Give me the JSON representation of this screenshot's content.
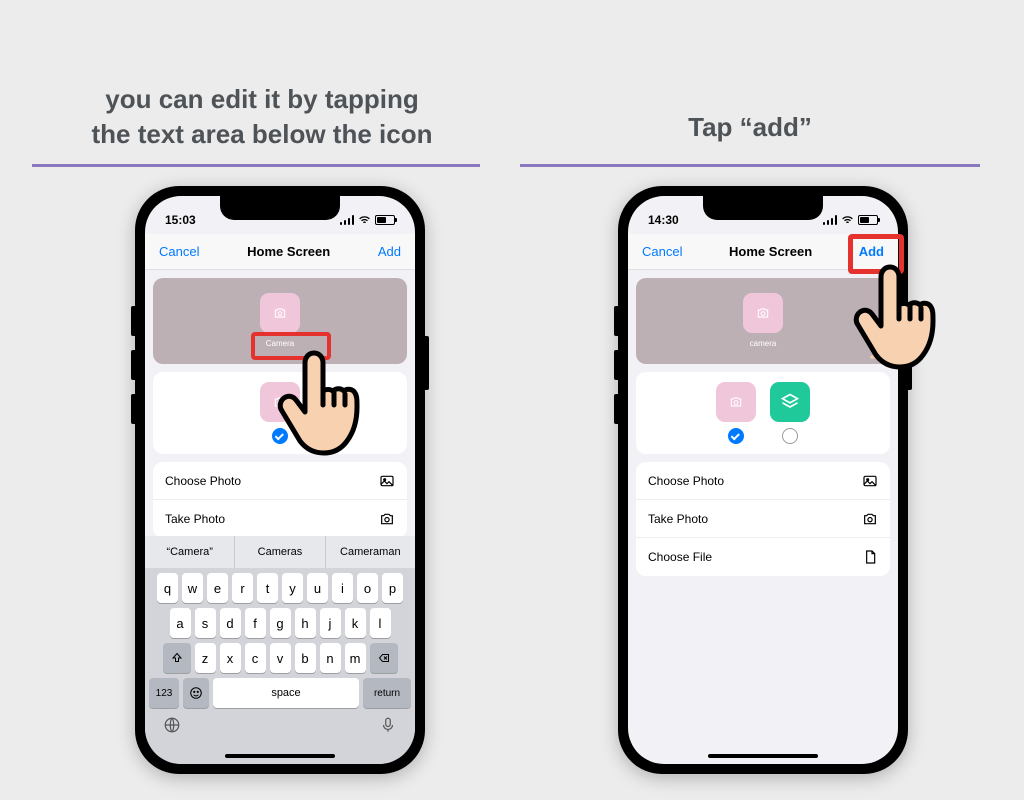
{
  "captions": {
    "left_line1": "you can edit it by tapping",
    "left_line2": "the text area below the icon",
    "right": "Tap “add”"
  },
  "phones": {
    "left": {
      "time": "15:03",
      "nav": {
        "cancel": "Cancel",
        "title": "Home Screen",
        "add": "Add"
      },
      "preview_label": "Camera",
      "rows": {
        "choose_photo": "Choose Photo",
        "take_photo": "Take Photo"
      },
      "suggestions": [
        "“Camera”",
        "Cameras",
        "Cameraman"
      ],
      "keys_r1": [
        "q",
        "w",
        "e",
        "r",
        "t",
        "y",
        "u",
        "i",
        "o",
        "p"
      ],
      "keys_r2": [
        "a",
        "s",
        "d",
        "f",
        "g",
        "h",
        "j",
        "k",
        "l"
      ],
      "keys_r3": [
        "z",
        "x",
        "c",
        "v",
        "b",
        "n",
        "m"
      ],
      "key_123": "123",
      "key_space": "space",
      "key_return": "return"
    },
    "right": {
      "time": "14:30",
      "nav": {
        "cancel": "Cancel",
        "title": "Home Screen",
        "add": "Add"
      },
      "preview_label": "camera",
      "rows": {
        "choose_photo": "Choose Photo",
        "take_photo": "Take Photo",
        "choose_file": "Choose File"
      }
    }
  }
}
